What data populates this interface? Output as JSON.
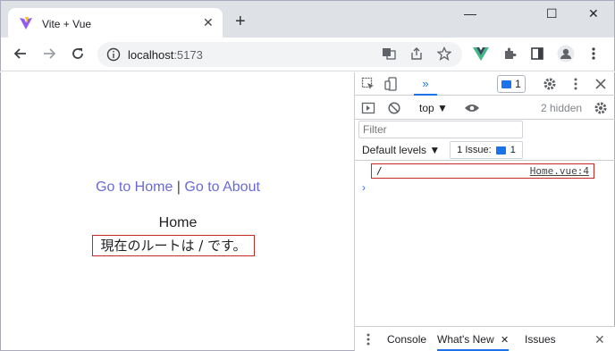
{
  "browser": {
    "tab_title": "Vite + Vue",
    "tab_close_glyph": "✕",
    "new_tab_glyph": "+",
    "url_host": "localhost",
    "url_port": ":5173",
    "minimize_glyph": "—",
    "maximize_glyph": "☐",
    "close_glyph": "✕"
  },
  "page": {
    "nav_home": "Go to Home",
    "nav_separator": "|",
    "nav_about": "Go to About",
    "heading": "Home",
    "route_message": "現在のルートは / です。"
  },
  "devtools": {
    "more_tabs_glyph": "»",
    "messages_count": "1",
    "context": "top ▼",
    "hidden_count": "2 hidden",
    "filter_placeholder": "Filter",
    "default_levels": "Default levels ▼",
    "issue_label": "1 Issue:",
    "issue_count": "1",
    "log_value": "/",
    "log_source": "Home.vue:4",
    "prompt_glyph": "›",
    "drawer_tabs": {
      "console": "Console",
      "whats_new": "What's New",
      "issues": "Issues"
    },
    "drawer_close_glyph": "✕"
  },
  "colors": {
    "link": "#6a6ad6",
    "highlight_border": "#c62828",
    "accent": "#1a73e8"
  }
}
